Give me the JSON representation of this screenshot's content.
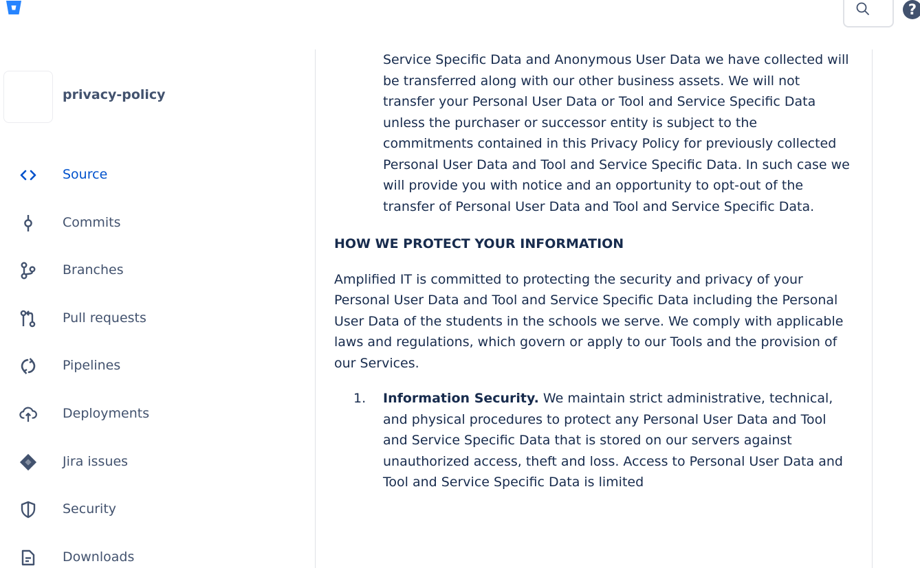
{
  "header": {
    "logo_icon": "bitbucket-logo-icon",
    "search_icon": "search-icon",
    "help_icon": "help-icon",
    "help_label": "?"
  },
  "repo": {
    "name": "privacy-policy"
  },
  "sidebar": {
    "active_color": "#0052cc",
    "items": [
      {
        "label": "Source",
        "icon": "source-icon",
        "active": true
      },
      {
        "label": "Commits",
        "icon": "commits-icon",
        "active": false
      },
      {
        "label": "Branches",
        "icon": "branches-icon",
        "active": false
      },
      {
        "label": "Pull requests",
        "icon": "pull-request-icon",
        "active": false
      },
      {
        "label": "Pipelines",
        "icon": "pipelines-icon",
        "active": false
      },
      {
        "label": "Deployments",
        "icon": "deployments-icon",
        "active": false
      },
      {
        "label": "Jira issues",
        "icon": "jira-icon",
        "active": false
      },
      {
        "label": "Security",
        "icon": "shield-icon",
        "active": false
      },
      {
        "label": "Downloads",
        "icon": "downloads-icon",
        "active": false
      }
    ]
  },
  "document": {
    "intro_paragraph": "Service Specific Data and Anonymous User Data we have collected will be transferred along with our other business assets. We will not transfer your Personal User Data or Tool and Service Specific Data unless the purchaser or successor entity is subject to the commitments contained in this Privacy Policy for previously collected Personal User Data and Tool and Service Specific Data. In such case we will provide you with notice and an opportunity to opt-out of the transfer of Personal User Data and Tool and Service Specific Data.",
    "section_heading": "HOW WE PROTECT YOUR INFORMATION",
    "section_paragraph": "Amplified IT is committed to protecting the security and privacy of your Personal User Data and Tool and Service Specific Data including the Personal User Data of the students in the schools we serve. We comply with applicable laws and regulations, which govern or apply to our Tools and the provision of our Services.",
    "list_items": [
      {
        "number": "1.",
        "title": "Information Security.",
        "text": " We maintain strict administrative, technical, and physical procedures to protect any Personal User Data and Tool and Service Specific Data that is stored on our servers against unauthorized access, theft and loss. Access to Personal User Data and Tool and Service Specific Data is limited"
      }
    ]
  }
}
